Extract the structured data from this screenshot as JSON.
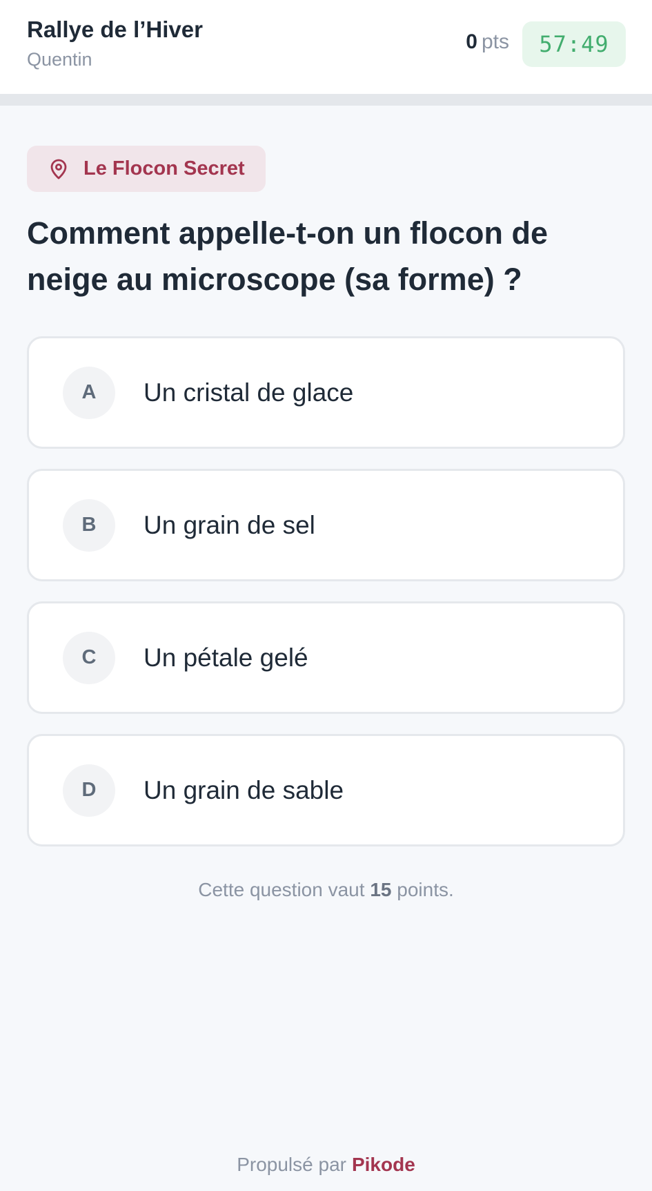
{
  "header": {
    "title": "Rallye de l’Hiver",
    "player": "Quentin",
    "score_value": "0",
    "score_unit": "pts",
    "timer": "57:49",
    "timer_color": "#42ad6e"
  },
  "progress": {
    "fraction": 0
  },
  "location": {
    "icon": "location-pin-icon",
    "label": "Le Flocon Secret",
    "color": "#a3354f"
  },
  "question": {
    "text": "Comment appelle-t-on un flocon de neige au microscope (sa forme) ?"
  },
  "answers": [
    {
      "letter": "A",
      "text": "Un cristal de glace"
    },
    {
      "letter": "B",
      "text": "Un grain de sel"
    },
    {
      "letter": "C",
      "text": "Un pétale gelé"
    },
    {
      "letter": "D",
      "text": "Un grain de sable"
    }
  ],
  "points_note": {
    "prefix": "Cette question vaut",
    "points": "15",
    "suffix": "points."
  },
  "footer": {
    "prefix": "Propulsé par",
    "brand": "Pikode",
    "brand_color": "#a3354f"
  }
}
